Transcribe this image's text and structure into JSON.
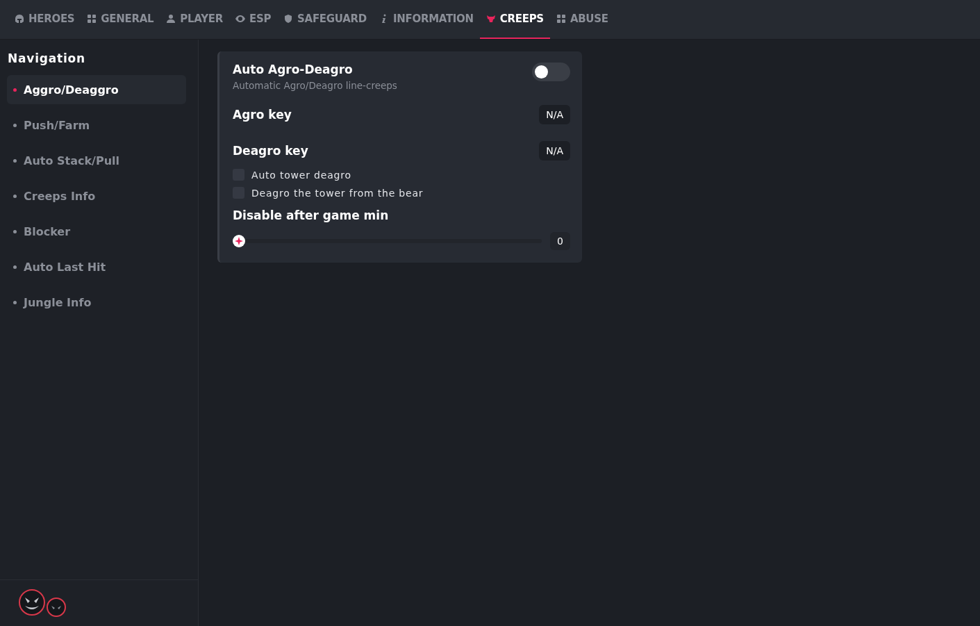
{
  "tabs": [
    {
      "label": "HEROES",
      "selected": false
    },
    {
      "label": "GENERAL",
      "selected": false
    },
    {
      "label": "PLAYER",
      "selected": false
    },
    {
      "label": "ESP",
      "selected": false
    },
    {
      "label": "SAFEGUARD",
      "selected": false
    },
    {
      "label": "INFORMATION",
      "selected": false
    },
    {
      "label": "CREEPS",
      "selected": true
    },
    {
      "label": "ABUSE",
      "selected": false
    }
  ],
  "sidebar": {
    "title": "Navigation",
    "items": [
      {
        "label": "Aggro/Deaggro",
        "selected": true
      },
      {
        "label": "Push/Farm",
        "selected": false
      },
      {
        "label": "Auto Stack/Pull",
        "selected": false
      },
      {
        "label": "Creeps Info",
        "selected": false
      },
      {
        "label": "Blocker",
        "selected": false
      },
      {
        "label": "Auto Last Hit",
        "selected": false
      },
      {
        "label": "Jungle Info",
        "selected": false
      }
    ]
  },
  "settings": [
    {
      "kind": "toggle",
      "label": "Auto Agro-Deagro",
      "description": "Automatic Agro/Deagro line-creeps",
      "on": false
    },
    {
      "kind": "key",
      "label": "Agro key",
      "value": "N/A"
    },
    {
      "kind": "key",
      "label": "Deagro key",
      "value": "N/A"
    },
    {
      "kind": "checkbox",
      "label": "Auto tower deagro",
      "checked": false
    },
    {
      "kind": "checkbox",
      "label": "Deagro the tower from the bear",
      "checked": false
    },
    {
      "kind": "slider",
      "label": "Disable after game min",
      "level": 0,
      "value": "0"
    }
  ]
}
